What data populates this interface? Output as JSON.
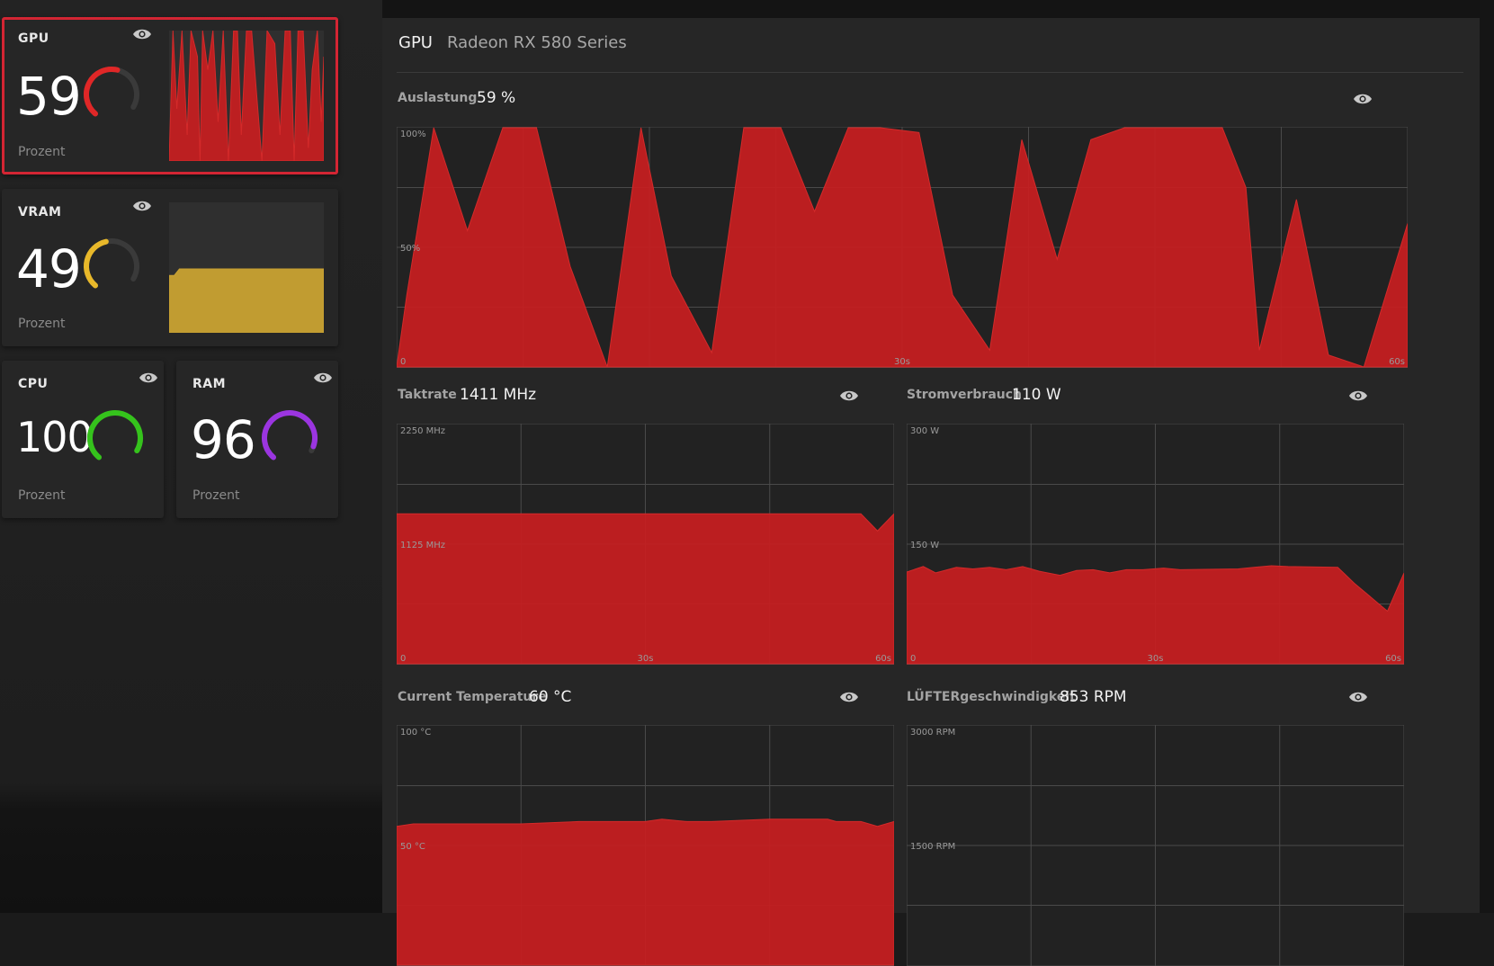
{
  "tiles": {
    "gpu": {
      "title": "GPU",
      "value": "59",
      "unit": "Prozent",
      "gauge_percent": 59,
      "color": "#e02727"
    },
    "vram": {
      "title": "VRAM",
      "value": "49",
      "unit": "Prozent",
      "gauge_percent": 49,
      "color": "#e8b82a"
    },
    "cpu": {
      "title": "CPU",
      "value": "100",
      "unit": "Prozent",
      "gauge_percent": 100,
      "color": "#35c31c"
    },
    "ram": {
      "title": "RAM",
      "value": "96",
      "unit": "Prozent",
      "gauge_percent": 96,
      "color": "#9b35e0"
    }
  },
  "panel": {
    "title": "GPU",
    "device": "Radeon RX 580 Series"
  },
  "metrics": {
    "usage": {
      "label": "Auslastung",
      "value": "59 %"
    },
    "clock": {
      "label": "Taktrate",
      "value": "1411 MHz"
    },
    "power": {
      "label": "Stromverbrauch",
      "value": "110 W"
    },
    "temp": {
      "label": "Current Temperature",
      "value": "60 °C"
    },
    "fan": {
      "label": "LÜFTERgeschwindigkeit",
      "value": "853 RPM"
    }
  },
  "colors": {
    "accent": "#c41f21",
    "vram": "#c9a232",
    "grid": "#4a4a4a",
    "chart_bg": "#222222"
  },
  "chart_data": [
    {
      "type": "area",
      "title": "Auslastung",
      "x_ticks": [
        "0",
        "30s",
        "60s"
      ],
      "y_ticks": [
        "100%",
        "50%"
      ],
      "ylim": [
        0,
        100
      ],
      "xlim": [
        0,
        60
      ],
      "color": "#c41f21",
      "points": [
        [
          0,
          0
        ],
        [
          0.6,
          30
        ],
        [
          2.2,
          100
        ],
        [
          4.2,
          57
        ],
        [
          6.3,
          100
        ],
        [
          8.3,
          100
        ],
        [
          10.3,
          42
        ],
        [
          12.5,
          0
        ],
        [
          14.5,
          100
        ],
        [
          16.3,
          38
        ],
        [
          18.7,
          6
        ],
        [
          20.6,
          100
        ],
        [
          22.8,
          100
        ],
        [
          24.8,
          65
        ],
        [
          26.8,
          100
        ],
        [
          28.7,
          100
        ],
        [
          31,
          98
        ],
        [
          33,
          30
        ],
        [
          35.2,
          7
        ],
        [
          37.1,
          95
        ],
        [
          39.2,
          45
        ],
        [
          41.2,
          95
        ],
        [
          43.2,
          100
        ],
        [
          49,
          100
        ],
        [
          50.4,
          75
        ],
        [
          51.2,
          7
        ],
        [
          53.4,
          70
        ],
        [
          55.3,
          5
        ],
        [
          57.4,
          0
        ],
        [
          60,
          60
        ]
      ]
    },
    {
      "type": "area",
      "title": "Taktrate",
      "x_ticks": [
        "0",
        "30s",
        "60s"
      ],
      "y_ticks": [
        "2250 MHz",
        "1125 MHz"
      ],
      "ylim": [
        0,
        2250
      ],
      "xlim": [
        0,
        60
      ],
      "color": "#c41f21",
      "points": [
        [
          0,
          1411
        ],
        [
          56,
          1411
        ],
        [
          58,
          1250
        ],
        [
          60,
          1411
        ]
      ]
    },
    {
      "type": "area",
      "title": "Stromverbrauch",
      "x_ticks": [
        "0",
        "30s",
        "60s"
      ],
      "y_ticks": [
        "300 W",
        "150 W"
      ],
      "ylim": [
        0,
        300
      ],
      "xlim": [
        0,
        60
      ],
      "color": "#c41f21",
      "points": [
        [
          0,
          115
        ],
        [
          2,
          122
        ],
        [
          3.5,
          114
        ],
        [
          6,
          121
        ],
        [
          8,
          119
        ],
        [
          10,
          121
        ],
        [
          12,
          118
        ],
        [
          14,
          122
        ],
        [
          16,
          116
        ],
        [
          18.5,
          111
        ],
        [
          20.5,
          117
        ],
        [
          22.5,
          118
        ],
        [
          24.5,
          114
        ],
        [
          26.5,
          118
        ],
        [
          28.5,
          118
        ],
        [
          31,
          120
        ],
        [
          33,
          118
        ],
        [
          40,
          119
        ],
        [
          44,
          123
        ],
        [
          46,
          122
        ],
        [
          52,
          121
        ],
        [
          54,
          101
        ],
        [
          58,
          66
        ],
        [
          60,
          114
        ]
      ]
    },
    {
      "type": "area",
      "title": "Current Temperature",
      "x_ticks": [],
      "y_ticks": [
        "100 °C",
        "50 °C"
      ],
      "ylim": [
        0,
        100
      ],
      "xlim": [
        0,
        60
      ],
      "color": "#c41f21",
      "points": [
        [
          0,
          58
        ],
        [
          2,
          59
        ],
        [
          5,
          59
        ],
        [
          10,
          59
        ],
        [
          15,
          59
        ],
        [
          22,
          60
        ],
        [
          30,
          60
        ],
        [
          32,
          61
        ],
        [
          35,
          60
        ],
        [
          38,
          60
        ],
        [
          45,
          61
        ],
        [
          50,
          61
        ],
        [
          52,
          61
        ],
        [
          53,
          60
        ],
        [
          56,
          60
        ],
        [
          58,
          58
        ],
        [
          60,
          60
        ]
      ]
    },
    {
      "type": "area",
      "title": "LÜFTERgeschwindigkeit",
      "x_ticks": [],
      "y_ticks": [
        "3000 RPM",
        "1500 RPM"
      ],
      "ylim": [
        0,
        3000
      ],
      "xlim": [
        0,
        60
      ],
      "color": "#c41f21",
      "points": []
    },
    {
      "type": "area",
      "title": "GPU",
      "color": "#c41f21",
      "ylim": [
        0,
        100
      ],
      "xlim": [
        0,
        60
      ],
      "points": [
        [
          0,
          0
        ],
        [
          1.5,
          100
        ],
        [
          3,
          40
        ],
        [
          5,
          100
        ],
        [
          7,
          20
        ],
        [
          8.5,
          100
        ],
        [
          11,
          80
        ],
        [
          12,
          0
        ],
        [
          13,
          100
        ],
        [
          15,
          70
        ],
        [
          17,
          100
        ],
        [
          19,
          30
        ],
        [
          21,
          100
        ],
        [
          23,
          0
        ],
        [
          25,
          100
        ],
        [
          26.5,
          100
        ],
        [
          28,
          20
        ],
        [
          30,
          100
        ],
        [
          32,
          100
        ],
        [
          34,
          50
        ],
        [
          36,
          0
        ],
        [
          38,
          100
        ],
        [
          41,
          90
        ],
        [
          43,
          20
        ],
        [
          45,
          100
        ],
        [
          47,
          100
        ],
        [
          48.5,
          0
        ],
        [
          50,
          100
        ],
        [
          52,
          100
        ],
        [
          54,
          10
        ],
        [
          55.5,
          70
        ],
        [
          57.5,
          100
        ],
        [
          59,
          30
        ],
        [
          60,
          80
        ]
      ]
    },
    {
      "type": "area",
      "title": "VRAM",
      "color": "#c9a232",
      "ylim": [
        0,
        100
      ],
      "xlim": [
        0,
        60
      ],
      "points": [
        [
          0,
          44
        ],
        [
          2,
          44
        ],
        [
          4,
          49
        ],
        [
          30,
          49
        ],
        [
          60,
          49
        ]
      ]
    },
    {
      "type": "sparkline",
      "title": "CPU",
      "points": []
    },
    {
      "type": "sparkline",
      "title": "RAM",
      "points": []
    }
  ]
}
